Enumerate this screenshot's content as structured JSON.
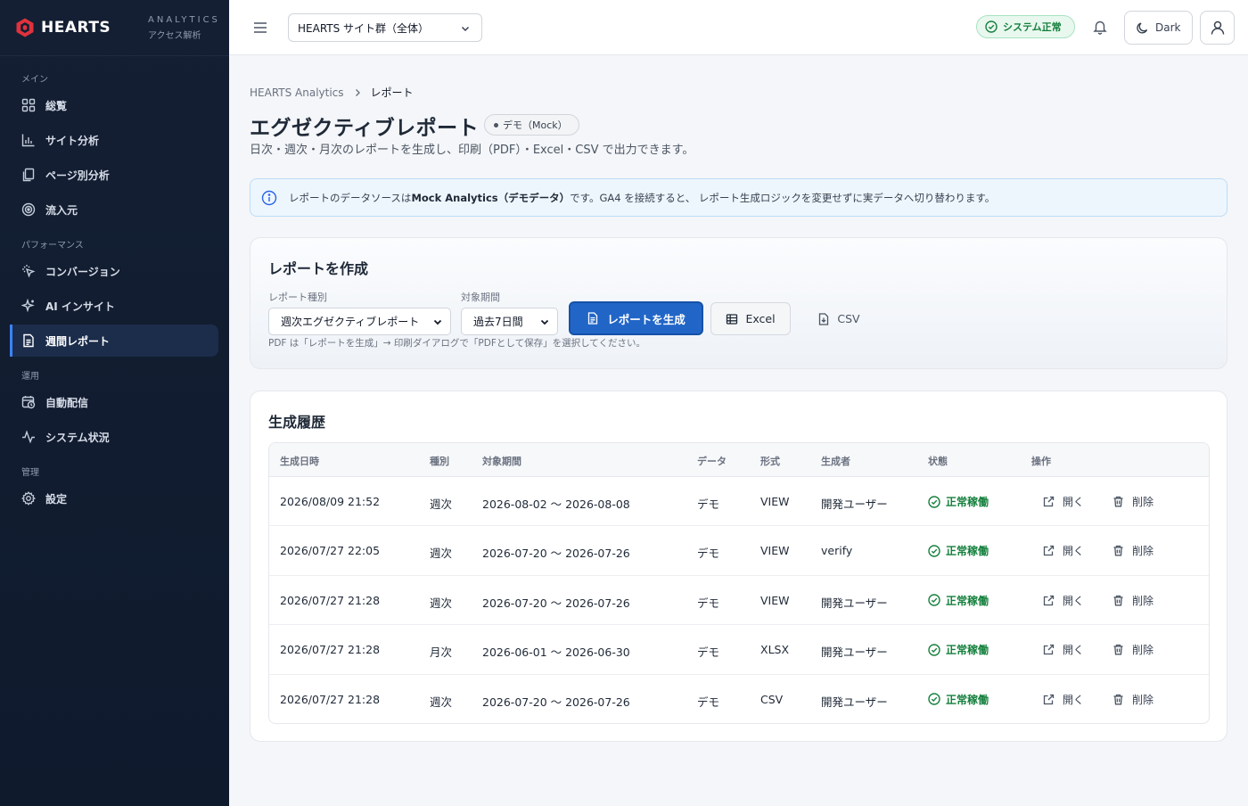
{
  "brand": {
    "name": "HEARTS",
    "sub1": "ANALYTICS",
    "sub2": "アクセス解析",
    "logo_color": "#e0323d"
  },
  "sidebar": {
    "sections": [
      {
        "label": "メイン",
        "items": [
          {
            "label": "総覧",
            "icon": "grid-icon"
          },
          {
            "label": "サイト分析",
            "icon": "bar-chart-icon"
          },
          {
            "label": "ページ別分析",
            "icon": "pages-icon"
          },
          {
            "label": "流入元",
            "icon": "target-icon"
          }
        ]
      },
      {
        "label": "パフォーマンス",
        "items": [
          {
            "label": "コンバージョン",
            "icon": "click-icon"
          },
          {
            "label": "AI インサイト",
            "icon": "sparkle-icon"
          },
          {
            "label": "週間レポート",
            "icon": "document-icon",
            "active": true
          }
        ]
      },
      {
        "label": "運用",
        "items": [
          {
            "label": "自動配信",
            "icon": "calendar-clock-icon"
          },
          {
            "label": "システム状況",
            "icon": "activity-icon"
          }
        ]
      },
      {
        "label": "管理",
        "items": [
          {
            "label": "設定",
            "icon": "gear-icon"
          }
        ]
      }
    ],
    "active_color": "#3b82f6"
  },
  "topbar": {
    "site_select": "HEARTS サイト群（全体）",
    "status": "システム正常",
    "theme_label": "Dark"
  },
  "breadcrumb": {
    "root": "HEARTS Analytics",
    "current": "レポート"
  },
  "page": {
    "title": "エグゼクティブレポート",
    "badge": "デモ（Mock）",
    "subtitle": "日次・週次・月次のレポートを生成し、印刷（PDF）・Excel・CSV で出力できます。"
  },
  "info": {
    "pre": "レポートのデータソースは ",
    "strong": "Mock Analytics（デモデータ）",
    "post": " です。GA4 を接続すると、 レポート生成ロジックを変更せずに実データへ切り替わります。"
  },
  "create": {
    "title": "レポートを作成",
    "type_label": "レポート種別",
    "type_value": "週次エグゼクティブレポート",
    "period_label": "対象期間",
    "period_value": "過去7日間",
    "generate": "レポートを生成",
    "excel": "Excel",
    "csv": "CSV",
    "hint": "PDF は「レポートを生成」→ 印刷ダイアログで「PDFとして保存」を選択してください。",
    "primary_color": "#2166c7"
  },
  "history": {
    "title": "生成履歴",
    "columns": [
      "生成日時",
      "種別",
      "対象期間",
      "データ",
      "形式",
      "生成者",
      "状態",
      "操作"
    ],
    "open_label": "開く",
    "delete_label": "削除",
    "status_color": "#15803d",
    "rows": [
      {
        "datetime": "2026/08/09 21:52",
        "kind": "週次",
        "period": "2026-08-02 〜 2026-08-08",
        "data": "デモ",
        "format": "VIEW",
        "creator": "開発ユーザー",
        "status": "正常稼働"
      },
      {
        "datetime": "2026/07/27 22:05",
        "kind": "週次",
        "period": "2026-07-20 〜 2026-07-26",
        "data": "デモ",
        "format": "VIEW",
        "creator": "verify",
        "status": "正常稼働"
      },
      {
        "datetime": "2026/07/27 21:28",
        "kind": "週次",
        "period": "2026-07-20 〜 2026-07-26",
        "data": "デモ",
        "format": "VIEW",
        "creator": "開発ユーザー",
        "status": "正常稼働"
      },
      {
        "datetime": "2026/07/27 21:28",
        "kind": "月次",
        "period": "2026-06-01 〜 2026-06-30",
        "data": "デモ",
        "format": "XLSX",
        "creator": "開発ユーザー",
        "status": "正常稼働"
      },
      {
        "datetime": "2026/07/27 21:28",
        "kind": "週次",
        "period": "2026-07-20 〜 2026-07-26",
        "data": "デモ",
        "format": "CSV",
        "creator": "開発ユーザー",
        "status": "正常稼働"
      }
    ]
  }
}
